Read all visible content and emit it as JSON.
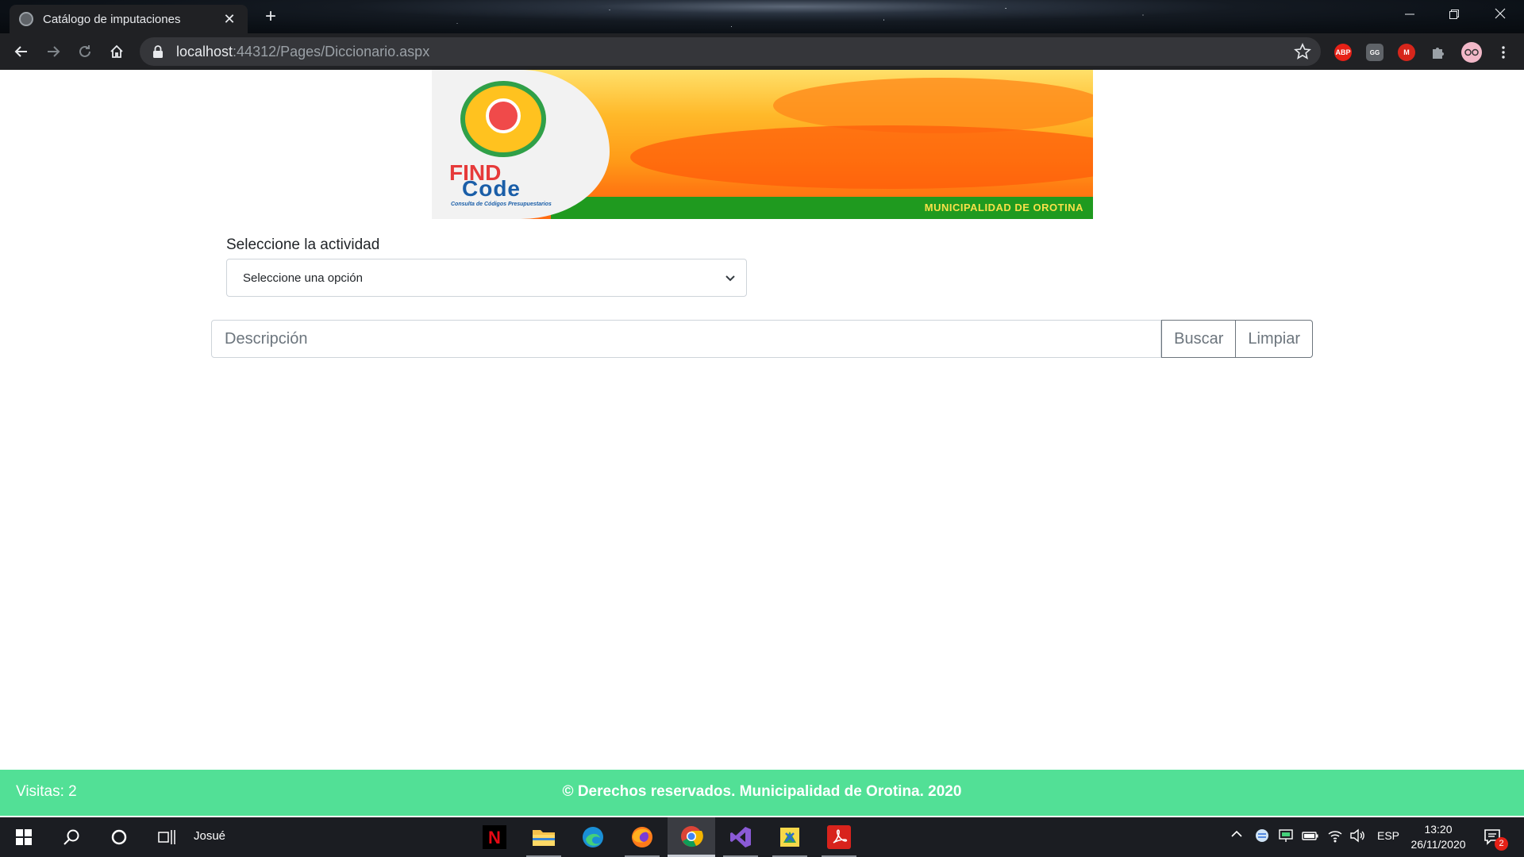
{
  "browser": {
    "tab_title": "Catálogo de imputaciones",
    "tab_close": "✕",
    "new_tab": "+",
    "url_host": "localhost",
    "url_path": ":44312/Pages/Diccionario.aspx",
    "extensions": [
      "ABP",
      "GG",
      "M"
    ]
  },
  "banner": {
    "logo_find": "FIND",
    "logo_code": "Code",
    "logo_subtitle": "Consulta de Códigos Presupuestarios",
    "municipality": "MUNICIPALIDAD DE OROTINA"
  },
  "form": {
    "activity_label": "Seleccione la actividad",
    "activity_selected": "Seleccione una opción",
    "description_placeholder": "Descripción",
    "search_button": "Buscar",
    "clear_button": "Limpiar"
  },
  "footer": {
    "visits": "Visitas: 2",
    "copyright": "© Derechos reservados. Municipalidad de Orotina. 2020"
  },
  "taskbar": {
    "user": "Josué",
    "language": "ESP",
    "time": "13:20",
    "date": "26/11/2020",
    "notification_count": "2",
    "apps": [
      "netflix",
      "file-explorer",
      "edge",
      "firefox",
      "chrome",
      "visual-studio",
      "sticky-app",
      "acrobat"
    ]
  },
  "colors": {
    "footer_bg": "#52e096",
    "chrome_dark": "#202124",
    "button_outline": "#6c757d"
  }
}
